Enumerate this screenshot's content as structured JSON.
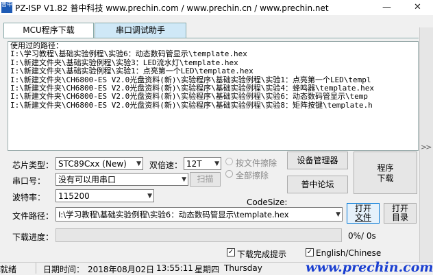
{
  "window": {
    "title": "PZ-ISP V1.82 普中科技  www.prechin.com / www.prechin.cn / www.prechin.net",
    "icon_text": "普中",
    "controls": [
      "minimize-icon",
      "maximize-icon",
      "close-icon"
    ]
  },
  "tabs": [
    {
      "label": "MCU程序下载",
      "active": true
    },
    {
      "label": "串口调试助手",
      "active": false
    }
  ],
  "history": {
    "lines": [
      "使用过的路径：",
      "I:\\学习教程\\基础实验例程\\实验6：动态数码管显示\\template.hex",
      "I:\\新建文件夹\\基础实验例程\\实验3：LED流水灯\\template.hex",
      "I:\\新建文件夹\\基础实验例程\\实验1：点亮第一个LED\\template.hex",
      "I:\\新建文件夹\\CH6800-ES V2.0光盘资料(新)\\实验程序\\基础实验例程\\实验1：点亮第一个LED\\templ",
      "I:\\新建文件夹\\CH6800-ES V2.0光盘资料(新)\\实验程序\\基础实验例程\\实验4：蜂鸣器\\template.hex",
      "I:\\新建文件夹\\CH6800-ES V2.0光盘资料(新)\\实验程序\\基础实验例程\\实验6：动态数码管显示\\temp",
      "I:\\新建文件夹\\CH6800-ES V2.0光盘资料(新)\\实验程序\\基础实验例程\\实验8：矩阵按键\\template.h"
    ]
  },
  "settings": {
    "chip_label": "芯片类型：",
    "chip_value": "STC89Cxx (New)",
    "double_speed_label": "双倍速：",
    "double_speed_value": "12T",
    "port_label": "串口号：",
    "port_value": "没有可以用串口",
    "scan_label": "扫描",
    "baud_label": "波特率：",
    "baud_value": "115200",
    "erase_by_file_label": "按文件擦除",
    "erase_all_label": "全部擦除",
    "codesize_label": "CodeSize:",
    "path_label": "文件路径：",
    "path_value": "I:\\学习教程\\基础实验例程\\实验6：动态数码管显示\\template.hex",
    "progress_label": "下载进度：",
    "progress_text": "0%/ 0s",
    "progress_fraction": 0,
    "download_done_prompt": "下载完成提示",
    "english_chinese": "English/Chinese"
  },
  "buttons": {
    "device_manager": "设备管理器",
    "forum": "普中论坛",
    "program_line1": "程序",
    "program_line2": "下载",
    "open_file_line1": "打开",
    "open_file_line2": "文件",
    "open_dir_line1": "打开",
    "open_dir_line2": "目录"
  },
  "status": {
    "state": "就绪",
    "date_label": "日期时间：",
    "date": "2018年08月02日",
    "time": "13:55:11",
    "weekday_cn": "星期四",
    "weekday_en": "Thursday",
    "watermark": "www.prechin.com"
  }
}
